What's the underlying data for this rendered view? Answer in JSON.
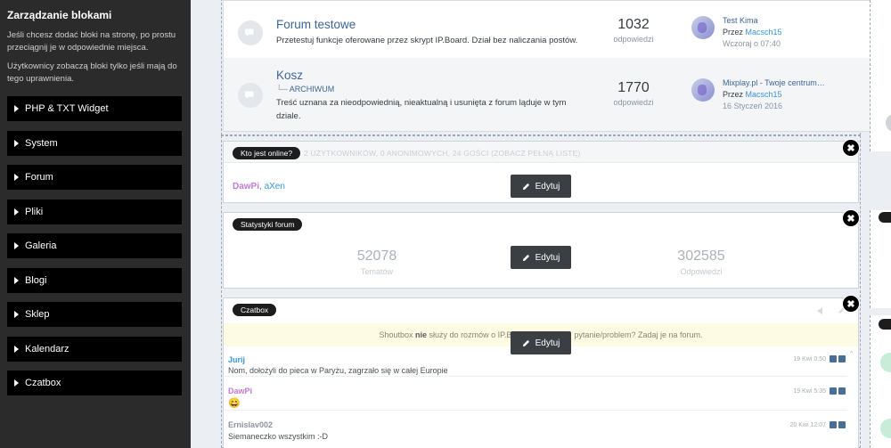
{
  "left_panel": {
    "title": "Zarządzanie blokami",
    "desc1": "Jeśli chcesz dodać bloki na stronę, po prostu przeciągnij je w odpowiednie miejsca.",
    "desc2": "Użytkownicy zobaczą bloki tylko jeśli mają do tego uprawnienia.",
    "items": [
      {
        "label": "PHP & TXT Widget"
      },
      {
        "label": "System"
      },
      {
        "label": "Forum"
      },
      {
        "label": "Pliki"
      },
      {
        "label": "Galeria"
      },
      {
        "label": "Blogi"
      },
      {
        "label": "Sklep"
      },
      {
        "label": "Kalendarz"
      },
      {
        "label": "Czatbox"
      }
    ]
  },
  "forums": [
    {
      "name": "Forum testowe",
      "desc": "Przetestuj funkcje oferowane przez skrypt IP.Board. Dział bez naliczania postów.",
      "count": "1032",
      "count_label": "odpowiedzi",
      "last_title": "Test Kima",
      "last_by_prefix": "Przez",
      "last_by": "Macsch15",
      "last_date": "Wczoraj o 07:40"
    },
    {
      "name": "Kosz",
      "sub_prefix": "└─",
      "sub": "ARCHIWUM",
      "desc": "Treść uznana za nieodpowiednią, nieaktualną i usunięta z forum ląduje w tym dziale.",
      "count": "1770",
      "count_label": "odpowiedzi",
      "last_title": "Mixplay.pl - Twoje centrum…",
      "last_by_prefix": "Przez",
      "last_by": "Macsch15",
      "last_date": "16 Styczeń 2016"
    }
  ],
  "online_widget": {
    "tag": "Kto jest online?",
    "summary": "2 UŻYTKOWNIKÓW, 0 ANONIMOWYCH, 24 GOŚCI (ZOBACZ PEŁNĄ LISTĘ)",
    "user1": "DawPi",
    "sep": ",",
    "user2": "aXen",
    "edit": "Edytuj",
    "close": "✖"
  },
  "stats_widget": {
    "tag": "Statystyki forum",
    "topics": "52078",
    "topics_label": "Tematów",
    "replies": "302585",
    "replies_label": "Odpowiedzi",
    "edit": "Edytuj",
    "close": "✖"
  },
  "chat_widget": {
    "tag": "Czatbox",
    "notice_pre": "Shoutbox",
    "notice_bold": "nie",
    "notice_post": "służy do rozmów o IP.B",
    "notice_end": "pytanie/problem? Zadaj je na forum.",
    "edit": "Edytuj",
    "close": "✖",
    "messages": [
      {
        "author": "Jurij",
        "text": "Nom, dołożyli do pieca w Paryżu, zagrzało się w całej Europie",
        "time": "19 Kwi 0:50"
      },
      {
        "author": "DawPi",
        "text": "😄",
        "time": "19 Kwi 5:35"
      },
      {
        "author": "Ernislav002",
        "text": "Siemaneczko wszystkim :-D",
        "time": "20 Kwi 12:07"
      }
    ]
  },
  "colors": {
    "accent": "#3d6594",
    "link": "#3d94d8",
    "admin": "#c27bd6",
    "panel": "#2b2b2b"
  }
}
